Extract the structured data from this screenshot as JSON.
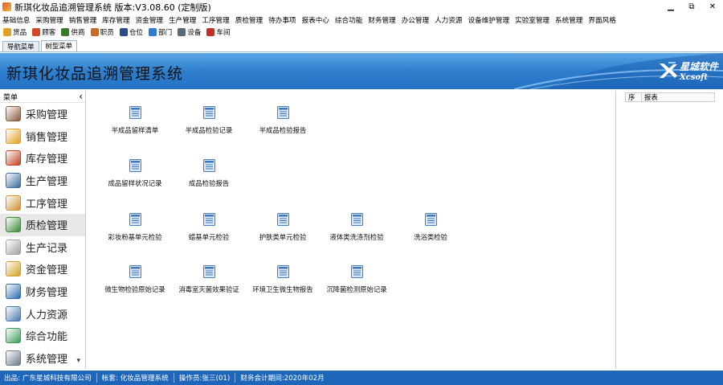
{
  "window": {
    "title": "新琪化妆品追溯管理系统  版本:V3.08.60 (定制版)",
    "controls": {
      "minimize": "▁",
      "restore": "⧉",
      "close": "✕"
    }
  },
  "menubar": [
    "基础信息",
    "采购管理",
    "销售管理",
    "库存管理",
    "资金管理",
    "生产管理",
    "工序管理",
    "质检管理",
    "待办事项",
    "报表中心",
    "综合功能",
    "财务管理",
    "办公管理",
    "人力资源",
    "设备维护管理",
    "实验室管理",
    "系统管理",
    "界面风格"
  ],
  "toolbar": [
    {
      "label": "货品",
      "icon": "goods-icon",
      "color": "#e0a020"
    },
    {
      "label": "顾客",
      "icon": "customer-icon",
      "color": "#d04a2a"
    },
    {
      "label": "供商",
      "icon": "supplier-icon",
      "color": "#3a7a2a"
    },
    {
      "label": "职员",
      "icon": "staff-icon",
      "color": "#c66a20"
    },
    {
      "label": "仓位",
      "icon": "warehouse-icon",
      "color": "#2a4a8a"
    },
    {
      "label": "部门",
      "icon": "department-icon",
      "color": "#2d7bd0"
    },
    {
      "label": "设备",
      "icon": "equipment-icon",
      "color": "#5a6a7a"
    },
    {
      "label": "车间",
      "icon": "workshop-icon",
      "color": "#c0302a"
    }
  ],
  "tabs": [
    {
      "label": "导航菜单",
      "active": false
    },
    {
      "label": "树型菜单",
      "active": true
    }
  ],
  "banner": {
    "title": "新琪化妆品追溯管理系统",
    "logo_cn": "星城软件",
    "logo_en": "Xcsoft"
  },
  "sidebar": {
    "header": "菜单",
    "collapse_glyph": "‹",
    "scroll_glyph": "▾",
    "items": [
      {
        "label": "采购管理",
        "icon": "cart-icon",
        "color": "#8a5a3a"
      },
      {
        "label": "销售管理",
        "icon": "sales-icon",
        "color": "#e0a020"
      },
      {
        "label": "库存管理",
        "icon": "home-icon",
        "color": "#c04020"
      },
      {
        "label": "生产管理",
        "icon": "clipboard-icon",
        "color": "#3a6aa0"
      },
      {
        "label": "工序管理",
        "icon": "process-icon",
        "color": "#d09030"
      },
      {
        "label": "质检管理",
        "icon": "checklist-icon",
        "color": "#3a8a3a",
        "active": true
      },
      {
        "label": "生产记录",
        "icon": "notepad-icon",
        "color": "#a0a0a0"
      },
      {
        "label": "资金管理",
        "icon": "coins-icon",
        "color": "#d0a020"
      },
      {
        "label": "财务管理",
        "icon": "sigma-icon",
        "color": "#2a6ab0"
      },
      {
        "label": "人力资源",
        "icon": "person-card-icon",
        "color": "#4a7ab0"
      },
      {
        "label": "综合功能",
        "icon": "sync-icon",
        "color": "#3a9a5a"
      },
      {
        "label": "系统管理",
        "icon": "gear-icon",
        "color": "#6a7a8a"
      }
    ]
  },
  "functions": [
    {
      "label": "半成品留样清单"
    },
    {
      "label": "半成品检验记录"
    },
    {
      "label": "半成品检验报告"
    },
    {
      "label": "成品留样状况记录"
    },
    {
      "label": "成品检验报告"
    },
    {
      "label": "彩妆粉基单元检验"
    },
    {
      "label": "蜡基单元检验"
    },
    {
      "label": "护肤类单元检验"
    },
    {
      "label": "液体类洗涤剂检验"
    },
    {
      "label": "洗浴类检验"
    },
    {
      "label": "微生物检验原始记录"
    },
    {
      "label": "消毒室灭菌效果验证"
    },
    {
      "label": "环境卫生微生物报告"
    },
    {
      "label": "沉降菌检测原始记录"
    }
  ],
  "right_panel": {
    "col1": "序",
    "col2": "报表"
  },
  "statusbar": [
    "出品: 广东星城科技有限公司",
    "帐套: 化妆品管理系统",
    "操作员:张三(01)",
    "财务会计期间:2020年02月"
  ]
}
